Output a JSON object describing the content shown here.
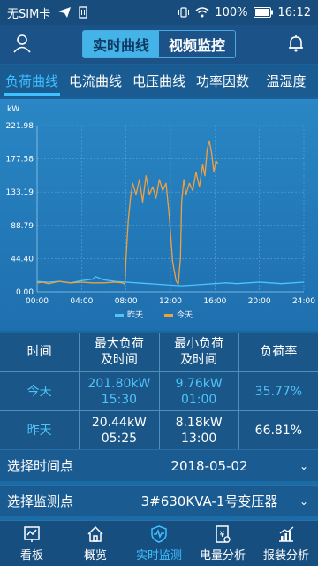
{
  "status": {
    "carrier": "无SIM卡",
    "battery": "100%",
    "time": "16:12"
  },
  "header": {
    "segment_realtime": "实时曲线",
    "segment_video": "视频监控"
  },
  "tabs": [
    "负荷曲线",
    "电流曲线",
    "电压曲线",
    "功率因数",
    "温湿度"
  ],
  "chart_data": {
    "type": "line",
    "unit_label": "kW",
    "x_ticks": [
      "00:00",
      "04:00",
      "08:00",
      "12:00",
      "16:00",
      "20:00",
      "24:00"
    ],
    "y_ticks": [
      "221.98",
      "177.58",
      "133.19",
      "88.79",
      "44.40",
      "0.00"
    ],
    "ylim": [
      0,
      221.98
    ],
    "xlim": [
      0,
      24
    ],
    "grid": true,
    "legend": "bottom",
    "series": [
      {
        "name": "昨天",
        "color": "#4fc3f7",
        "x": [
          0,
          1,
          2,
          3,
          4,
          5,
          5.25,
          6,
          7,
          8,
          9,
          10,
          11,
          12,
          13,
          14,
          15,
          16,
          17,
          18,
          19,
          20,
          21,
          22,
          23,
          24
        ],
        "y": [
          14,
          13,
          14,
          12,
          15,
          17,
          20.44,
          16,
          14,
          13,
          12,
          11,
          10,
          9,
          8.18,
          9,
          10,
          11,
          12,
          11,
          12,
          13,
          12,
          11,
          12,
          13
        ]
      },
      {
        "name": "今天",
        "color": "#f0a040",
        "x": [
          0,
          0.5,
          1,
          2,
          3,
          4,
          5,
          6,
          7,
          7.7,
          7.9,
          8.0,
          8.2,
          8.4,
          8.6,
          8.9,
          9.2,
          9.5,
          9.8,
          10.1,
          10.4,
          10.7,
          11.0,
          11.3,
          11.6,
          11.9,
          12.2,
          12.5,
          12.7,
          12.9,
          13.0,
          13.2,
          13.4,
          13.7,
          14.0,
          14.3,
          14.6,
          14.9,
          15.1,
          15.3,
          15.5,
          15.7,
          15.9,
          16.1,
          16.3
        ],
        "y": [
          12,
          13,
          11,
          14,
          12,
          13,
          12,
          12,
          13,
          12,
          10,
          45,
          95,
          125,
          145,
          130,
          150,
          120,
          155,
          130,
          140,
          125,
          150,
          135,
          145,
          100,
          40,
          15,
          10,
          45,
          120,
          150,
          130,
          145,
          135,
          160,
          140,
          170,
          155,
          190,
          201.8,
          185,
          160,
          175,
          170
        ]
      }
    ]
  },
  "table": {
    "headers": [
      "时间",
      "最大负荷\n及时间",
      "最小负荷\n及时间",
      "负荷率"
    ],
    "rows": [
      {
        "label": "今天",
        "max_value": "201.80kW",
        "max_time": "15:30",
        "min_value": "9.76kW",
        "min_time": "01:00",
        "rate": "35.77%"
      },
      {
        "label": "昨天",
        "max_value": "20.44kW",
        "max_time": "05:25",
        "min_value": "8.18kW",
        "min_time": "13:00",
        "rate": "66.81%"
      }
    ]
  },
  "time_selector": {
    "label": "选择时间点",
    "value": "2018-05-02"
  },
  "point_selector": {
    "label": "选择监测点",
    "value": "3#630KVA-1号变压器"
  },
  "bottom_nav": [
    {
      "label": "看板",
      "icon": "dashboard-icon"
    },
    {
      "label": "概览",
      "icon": "home-icon"
    },
    {
      "label": "实时监测",
      "icon": "monitor-icon"
    },
    {
      "label": "电量分析",
      "icon": "power-analysis-icon"
    },
    {
      "label": "报装分析",
      "icon": "chart-analysis-icon"
    }
  ],
  "colors": {
    "accent": "#3ec1ff",
    "today_line": "#f0a040",
    "yesterday_line": "#4fc3f7"
  }
}
